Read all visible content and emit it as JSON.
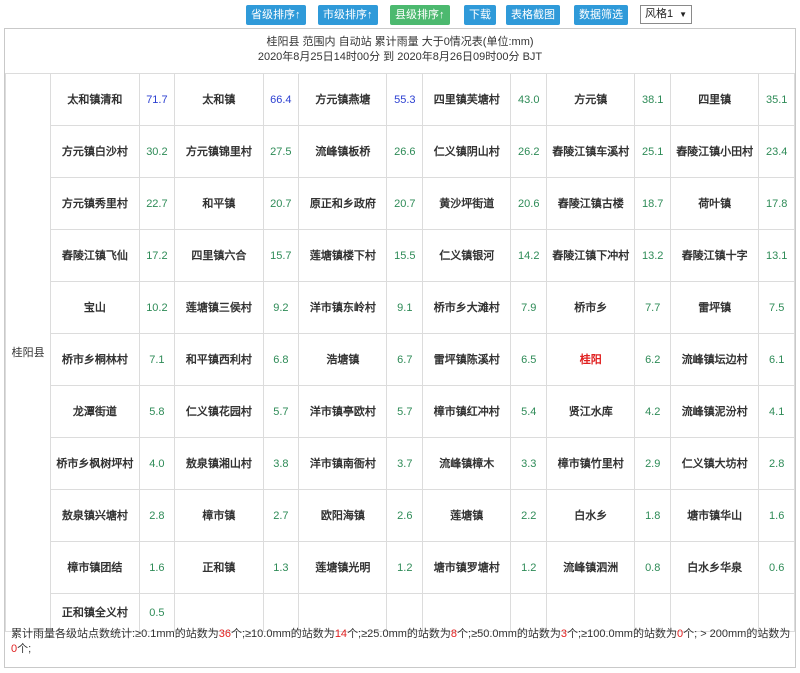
{
  "toolbar": {
    "buttons": [
      {
        "label": "省级排序↑",
        "color": "blue"
      },
      {
        "label": "市级排序↑",
        "color": "blue"
      },
      {
        "label": "县级排序↑",
        "color": "green"
      },
      {
        "label": "下载",
        "color": "blue"
      },
      {
        "label": "表格截图",
        "color": "blue"
      },
      {
        "label": "数据筛选",
        "color": "blue"
      }
    ],
    "style_select": "风格1"
  },
  "title": {
    "line1": "桂阳县 范围内 自动站 累计雨量 大于0情况表(单位:mm)",
    "line2": "2020年8月25日14时00分 到 2020年8月26日09时00分 BJT"
  },
  "region": "桂阳县",
  "rows": [
    [
      [
        "太和镇清和",
        "71.7"
      ],
      [
        "太和镇",
        "66.4"
      ],
      [
        "方元镇燕塘",
        "55.3"
      ],
      [
        "四里镇芙塘村",
        "43.0"
      ],
      [
        "方元镇",
        "38.1"
      ],
      [
        "四里镇",
        "35.1"
      ]
    ],
    [
      [
        "方元镇白沙村",
        "30.2"
      ],
      [
        "方元镇锦里村",
        "27.5"
      ],
      [
        "流峰镇板桥",
        "26.6"
      ],
      [
        "仁义镇阴山村",
        "26.2"
      ],
      [
        "舂陵江镇车溪村",
        "25.1"
      ],
      [
        "舂陵江镇小田村",
        "23.4"
      ]
    ],
    [
      [
        "方元镇秀里村",
        "22.7"
      ],
      [
        "和平镇",
        "20.7"
      ],
      [
        "原正和乡政府",
        "20.7"
      ],
      [
        "黄沙坪街道",
        "20.6"
      ],
      [
        "舂陵江镇古楼",
        "18.7"
      ],
      [
        "荷叶镇",
        "17.8"
      ]
    ],
    [
      [
        "舂陵江镇飞仙",
        "17.2"
      ],
      [
        "四里镇六合",
        "15.7"
      ],
      [
        "莲塘镇楼下村",
        "15.5"
      ],
      [
        "仁义镇银河",
        "14.2"
      ],
      [
        "舂陵江镇下冲村",
        "13.2"
      ],
      [
        "舂陵江镇十字",
        "13.1"
      ]
    ],
    [
      [
        "宝山",
        "10.2"
      ],
      [
        "莲塘镇三侯村",
        "9.2"
      ],
      [
        "洋市镇东岭村",
        "9.1"
      ],
      [
        "桥市乡大滩村",
        "7.9"
      ],
      [
        "桥市乡",
        "7.7"
      ],
      [
        "雷坪镇",
        "7.5"
      ]
    ],
    [
      [
        "桥市乡桐林村",
        "7.1"
      ],
      [
        "和平镇西利村",
        "6.8"
      ],
      [
        "浩塘镇",
        "6.7"
      ],
      [
        "雷坪镇陈溪村",
        "6.5"
      ],
      [
        "桂阳",
        "6.2"
      ],
      [
        "流峰镇坛边村",
        "6.1"
      ]
    ],
    [
      [
        "龙潭街道",
        "5.8"
      ],
      [
        "仁义镇花园村",
        "5.7"
      ],
      [
        "洋市镇亭欧村",
        "5.7"
      ],
      [
        "樟市镇红冲村",
        "5.4"
      ],
      [
        "贤江水库",
        "4.2"
      ],
      [
        "流峰镇泥汾村",
        "4.1"
      ]
    ],
    [
      [
        "桥市乡枫树坪村",
        "4.0"
      ],
      [
        "敖泉镇湘山村",
        "3.8"
      ],
      [
        "洋市镇南衙村",
        "3.7"
      ],
      [
        "流峰镇樟木",
        "3.3"
      ],
      [
        "樟市镇竹里村",
        "2.9"
      ],
      [
        "仁义镇大坊村",
        "2.8"
      ]
    ],
    [
      [
        "敖泉镇兴塘村",
        "2.8"
      ],
      [
        "樟市镇",
        "2.7"
      ],
      [
        "欧阳海镇",
        "2.6"
      ],
      [
        "莲塘镇",
        "2.2"
      ],
      [
        "白水乡",
        "1.8"
      ],
      [
        "塘市镇华山",
        "1.6"
      ]
    ],
    [
      [
        "樟市镇团结",
        "1.6"
      ],
      [
        "正和镇",
        "1.3"
      ],
      [
        "莲塘镇光明",
        "1.2"
      ],
      [
        "塘市镇罗塘村",
        "1.2"
      ],
      [
        "流峰镇泗洲",
        "0.8"
      ],
      [
        "白水乡华泉",
        "0.6"
      ]
    ],
    [
      [
        "正和镇全义村",
        "0.5"
      ],
      [
        "",
        ""
      ],
      [
        "",
        ""
      ],
      [
        "",
        ""
      ],
      [
        "",
        ""
      ],
      [
        "",
        ""
      ]
    ]
  ],
  "highlight_names": [
    "桂阳"
  ],
  "blue_values": [
    "71.7",
    "66.4",
    "55.3"
  ],
  "colors": {
    "value_green": "#2e8b57",
    "value_blue": "#2b3fd1",
    "highlight_red": "#e02020",
    "button_blue": "#2f9ad9",
    "button_green": "#4cb96f"
  },
  "footer": {
    "parts": [
      {
        "t": "累计雨量各级站点数统计:≥0.1mm的站数为",
        "r": false
      },
      {
        "t": "36",
        "r": true
      },
      {
        "t": "个;≥10.0mm的站数为",
        "r": false
      },
      {
        "t": "14",
        "r": true
      },
      {
        "t": "个;≥25.0mm的站数为",
        "r": false
      },
      {
        "t": "8",
        "r": true
      },
      {
        "t": "个;≥50.0mm的站数为",
        "r": false
      },
      {
        "t": "3",
        "r": true
      },
      {
        "t": "个;≥100.0mm的站数为",
        "r": false
      },
      {
        "t": "0",
        "r": true
      },
      {
        "t": "个; > 200mm的站数为",
        "r": false
      },
      {
        "t": "0",
        "r": true
      },
      {
        "t": "个;",
        "r": false
      }
    ]
  }
}
